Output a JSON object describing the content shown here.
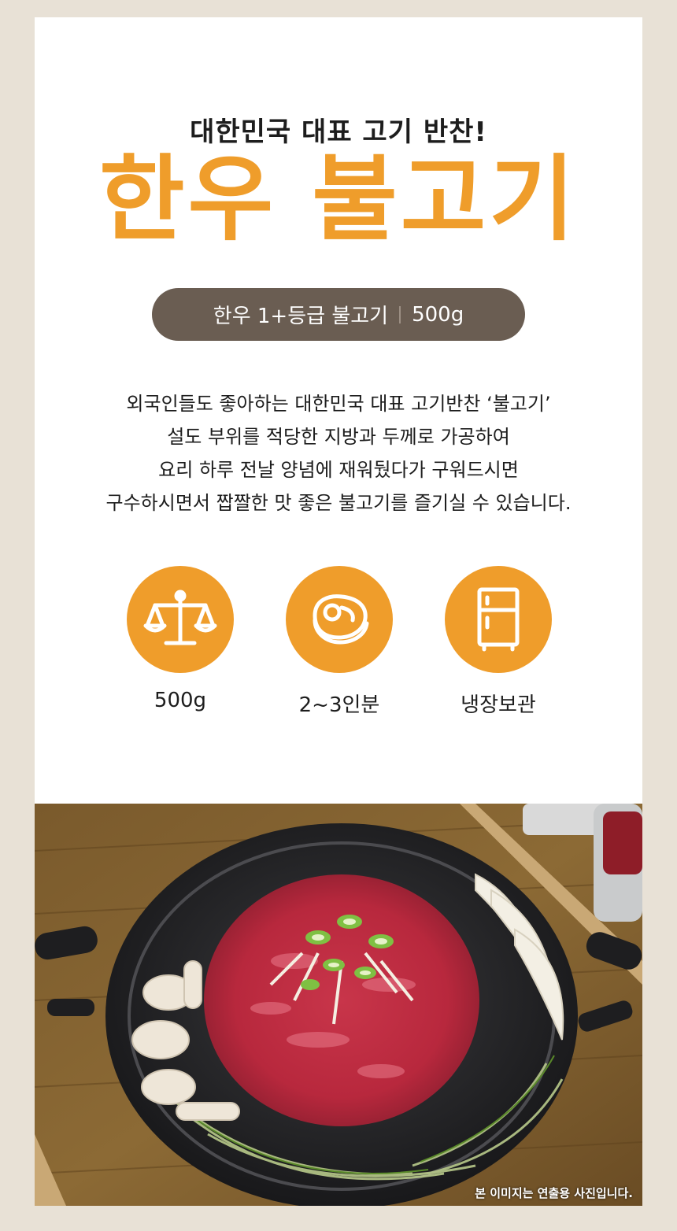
{
  "header": {
    "subtitle": "대한민국 대표 고기 반찬!",
    "title": "한우 불고기"
  },
  "spec_pill": {
    "grade": "한우 1+등급 불고기",
    "weight": "500g"
  },
  "description": [
    "외국인들도 좋아하는 대한민국 대표 고기반찬 ‘불고기’",
    "설도 부위를 적당한 지방과 두께로 가공하여",
    "요리 하루 전날 양념에 재워뒀다가 구워드시면",
    "구수하시면서 짭짤한 맛 좋은 불고기를 즐기실 수 있습니다."
  ],
  "features": [
    {
      "icon": "scale-icon",
      "label": "500g"
    },
    {
      "icon": "steak-icon",
      "label": "2~3인분"
    },
    {
      "icon": "refrigerator-icon",
      "label": "냉장보관"
    }
  ],
  "photo": {
    "caption": "본 이미지는 연출용 사진입니다."
  },
  "colors": {
    "accent": "#ef9d2b",
    "pill": "#6a5d52",
    "page_bg": "#e8e1d6"
  }
}
